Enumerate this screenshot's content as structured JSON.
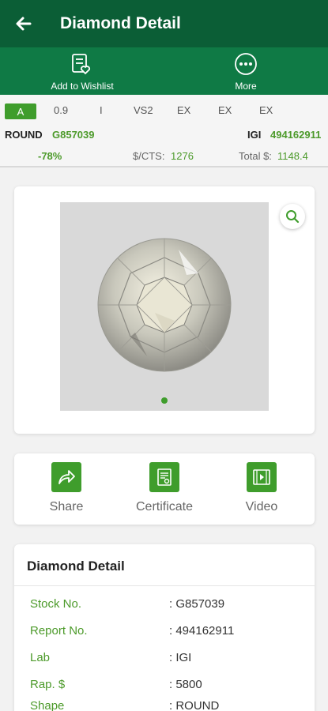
{
  "appbar": {
    "title": "Diamond Detail",
    "back_icon": "arrow-left-icon"
  },
  "actions": {
    "wishlist_label": "Add to Wishlist",
    "more_label": "More"
  },
  "summary": {
    "grade": "A",
    "carat": "0.9",
    "color": "I",
    "clarity": "VS2",
    "cut": "EX",
    "polish": "EX",
    "symmetry": "EX",
    "shape": "ROUND",
    "stock": "G857039",
    "lab": "IGI",
    "report": "494162911",
    "discount": "-78%",
    "price_per_ct_label": "$/CTS:",
    "price_per_ct": "1276",
    "total_label": "Total $:",
    "total": "1148.4"
  },
  "gallery": {
    "page_count": 1,
    "active_index": 0
  },
  "share_bar": {
    "share_label": "Share",
    "certificate_label": "Certificate",
    "video_label": "Video"
  },
  "details": {
    "title": "Diamond Detail",
    "rows": [
      {
        "key": "Stock No.",
        "value": ": G857039"
      },
      {
        "key": "Report No.",
        "value": ": 494162911"
      },
      {
        "key": "Lab",
        "value": ": IGI"
      },
      {
        "key": "Rap. $",
        "value": ": 5800"
      },
      {
        "key": "Shape",
        "value": ": ROUND"
      }
    ]
  },
  "colors": {
    "primary_dark": "#0b5e36",
    "primary": "#0f7a45",
    "accent": "#3f9d2c"
  }
}
